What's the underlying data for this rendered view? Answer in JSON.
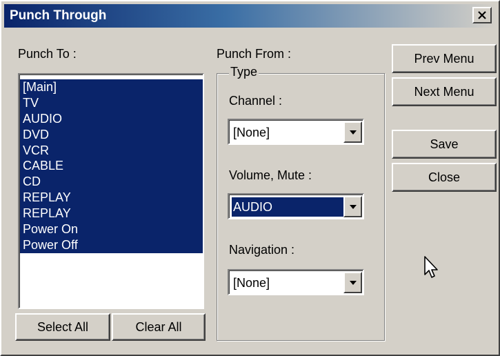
{
  "window": {
    "title": "Punch Through",
    "close_glyph": "×"
  },
  "punch_to": {
    "label": "Punch To :",
    "items": [
      "[Main]",
      "TV",
      "AUDIO",
      "DVD",
      "VCR",
      "CABLE",
      "CD",
      "REPLAY",
      "REPLAY",
      "Power On",
      "Power Off"
    ],
    "select_all_label": "Select All",
    "clear_all_label": "Clear All"
  },
  "punch_from": {
    "label": "Punch From :",
    "group_label": "Type",
    "channel": {
      "label": "Channel :",
      "value": "[None]"
    },
    "volume": {
      "label": "Volume, Mute :",
      "value": "AUDIO"
    },
    "navigation": {
      "label": "Navigation :",
      "value": "[None]"
    }
  },
  "buttons": {
    "prev_menu": "Prev Menu",
    "next_menu": "Next Menu",
    "save": "Save",
    "close": "Close"
  },
  "colors": {
    "face": "#d4d0c8",
    "selection": "#0a246a",
    "title_start": "#0a246a",
    "title_end": "#d4d0c8"
  },
  "icons": [
    "close-icon",
    "dropdown-arrow-icon",
    "mouse-pointer-icon"
  ]
}
